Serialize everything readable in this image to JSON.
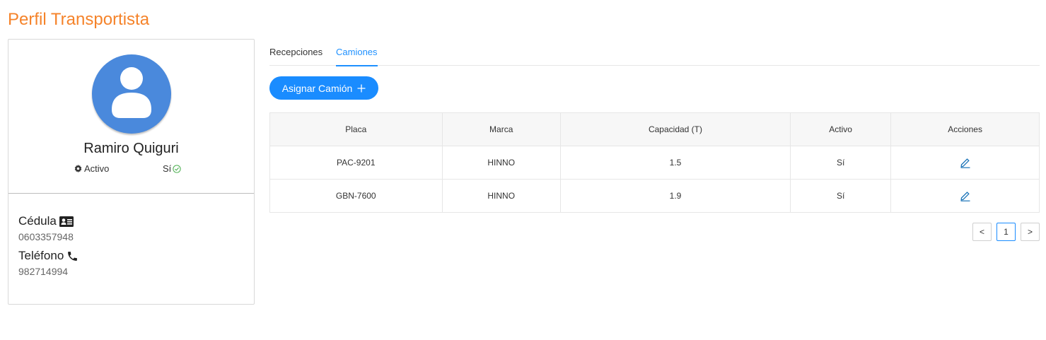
{
  "page": {
    "title": "Perfil Transportista"
  },
  "profile": {
    "name": "Ramiro Quiguri",
    "status_label": "Activo",
    "status_value": "Sí",
    "cedula_label": "Cédula",
    "cedula_value": "0603357948",
    "phone_label": "Teléfono",
    "phone_value": "982714994"
  },
  "tabs": [
    {
      "label": "Recepciones",
      "active": false
    },
    {
      "label": "Camiones",
      "active": true
    }
  ],
  "actions": {
    "assign_label": "Asignar Camión",
    "assign_icon": "plus-icon"
  },
  "table": {
    "columns": [
      "Placa",
      "Marca",
      "Capacidad (T)",
      "Activo",
      "Acciones"
    ],
    "rows": [
      {
        "placa": "PAC-9201",
        "marca": "HINNO",
        "capacidad": "1.5",
        "activo": "Sí",
        "action_icon": "edit-icon"
      },
      {
        "placa": "GBN-7600",
        "marca": "HINNO",
        "capacidad": "1.9",
        "activo": "Sí",
        "action_icon": "edit-icon"
      }
    ]
  },
  "pagination": {
    "prev": "<",
    "current": "1",
    "next": ">"
  },
  "colors": {
    "title": "#f5832a",
    "accent": "#1a8cff",
    "avatar": "#4a89dc",
    "success": "#4caf50"
  }
}
